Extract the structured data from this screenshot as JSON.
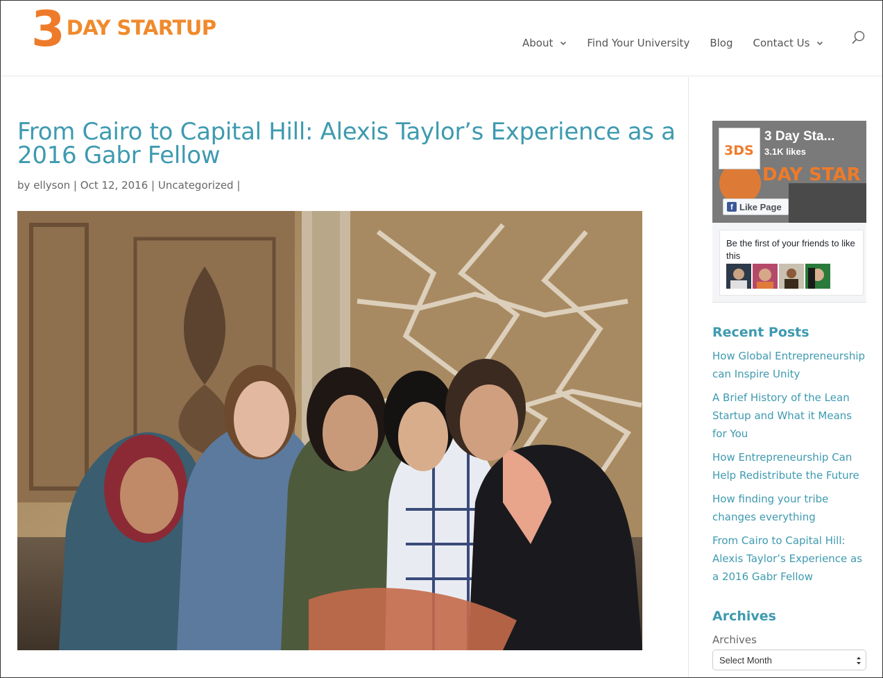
{
  "header": {
    "logo_numeral": "3",
    "logo_text": "DAY STARTUP",
    "nav": [
      {
        "label": "About",
        "has_dropdown": true
      },
      {
        "label": "Find Your University",
        "has_dropdown": false
      },
      {
        "label": "Blog",
        "has_dropdown": false
      },
      {
        "label": "Contact Us",
        "has_dropdown": true
      }
    ],
    "search_icon": "search-icon"
  },
  "post": {
    "title": "From Cairo to Capital Hill: Alexis Taylor’s Experience as a 2016 Gabr Fellow",
    "meta": {
      "by": "by",
      "author": "ellyson",
      "sep1": "|",
      "date": "Oct 12, 2016",
      "sep2": "|",
      "category": "Uncategorized",
      "sep3": "|"
    }
  },
  "sidebar": {
    "facebook": {
      "logo_text": "3DS",
      "page_name": "3 Day Sta...",
      "likes": "3.1K likes",
      "cover_text": "DAY STAR",
      "like_button": "Like Page",
      "friends_text": "Be the first of your friends to like this"
    },
    "recent_posts": {
      "title": "Recent Posts",
      "items": [
        "How Global Entrepreneurship can Inspire Unity",
        "A Brief History of the Lean Startup and What it Means for You",
        "How Entrepreneurship Can Help Redistribute the Future",
        "How finding your tribe changes everything",
        "From Cairo to Capital Hill: Alexis Taylor’s Experience as a 2016 Gabr Fellow"
      ]
    },
    "archives": {
      "title": "Archives",
      "label": "Archives",
      "select_value": "Select Month"
    }
  },
  "colors": {
    "accent": "#3e9ab0",
    "brand_orange": "#ee7b2a",
    "facebook_blue": "#3b5998"
  }
}
